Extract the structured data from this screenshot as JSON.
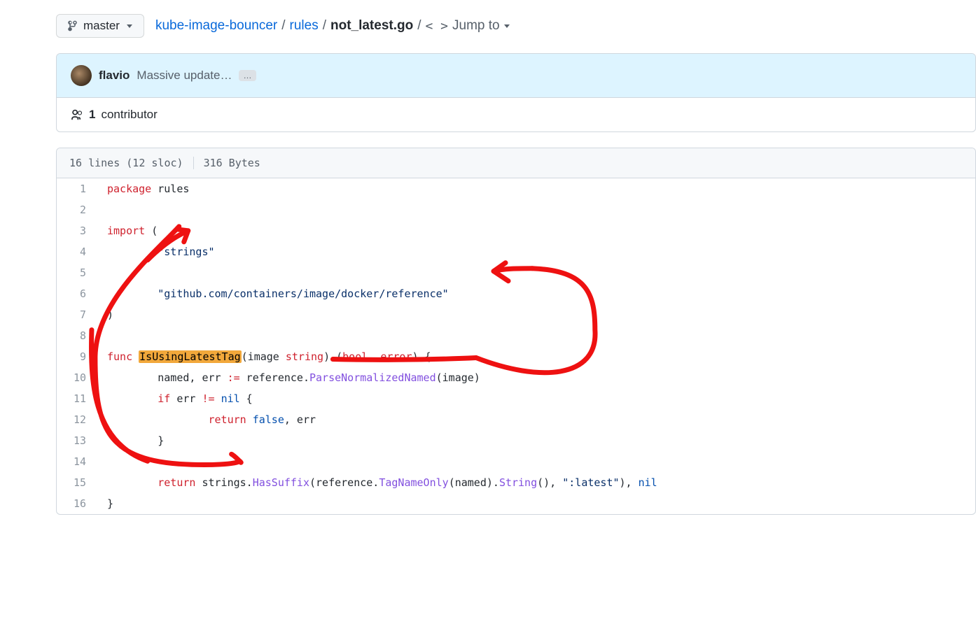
{
  "branch": {
    "label": "master"
  },
  "breadcrumb": {
    "repo": "kube-image-bouncer",
    "dir": "rules",
    "file": "not_latest.go",
    "sep": "/",
    "jump_to": "Jump to"
  },
  "commit": {
    "author": "flavio",
    "message": "Massive update…",
    "expand": "…"
  },
  "contributors": {
    "count": "1",
    "label": "contributor"
  },
  "blob_info": {
    "lines_sloc": "16 lines (12 sloc)",
    "bytes": "316 Bytes"
  },
  "code": {
    "lines": [
      {
        "n": "1",
        "t": [
          {
            "c": "kw",
            "v": "package"
          },
          {
            "v": " rules"
          }
        ]
      },
      {
        "n": "2",
        "t": []
      },
      {
        "n": "3",
        "t": [
          {
            "c": "kw",
            "v": "import"
          },
          {
            "v": " ("
          }
        ]
      },
      {
        "n": "4",
        "t": [
          {
            "v": "        "
          },
          {
            "c": "str",
            "v": "\"strings\""
          }
        ]
      },
      {
        "n": "5",
        "t": []
      },
      {
        "n": "6",
        "t": [
          {
            "v": "        "
          },
          {
            "c": "str",
            "v": "\"github.com/containers/image/docker/reference\""
          }
        ]
      },
      {
        "n": "7",
        "t": [
          {
            "v": ")"
          }
        ]
      },
      {
        "n": "8",
        "t": []
      },
      {
        "n": "9",
        "t": [
          {
            "c": "kw",
            "v": "func"
          },
          {
            "v": " "
          },
          {
            "c": "hl",
            "v": "IsUsingLatestTag"
          },
          {
            "v": "(image "
          },
          {
            "c": "kw",
            "v": "string"
          },
          {
            "v": ") ("
          },
          {
            "c": "kw",
            "v": "bool"
          },
          {
            "v": ", "
          },
          {
            "c": "kw",
            "v": "error"
          },
          {
            "v": ") {"
          }
        ]
      },
      {
        "n": "10",
        "t": [
          {
            "v": "        named, err "
          },
          {
            "c": "kw",
            "v": ":="
          },
          {
            "v": " reference."
          },
          {
            "c": "fn-call",
            "v": "ParseNormalizedNamed"
          },
          {
            "v": "(image)"
          }
        ]
      },
      {
        "n": "11",
        "t": [
          {
            "v": "        "
          },
          {
            "c": "kw",
            "v": "if"
          },
          {
            "v": " err "
          },
          {
            "c": "kw",
            "v": "!="
          },
          {
            "v": " "
          },
          {
            "c": "nil",
            "v": "nil"
          },
          {
            "v": " {"
          }
        ]
      },
      {
        "n": "12",
        "t": [
          {
            "v": "                "
          },
          {
            "c": "kw",
            "v": "return"
          },
          {
            "v": " "
          },
          {
            "c": "nil",
            "v": "false"
          },
          {
            "v": ", err"
          }
        ]
      },
      {
        "n": "13",
        "t": [
          {
            "v": "        }"
          }
        ]
      },
      {
        "n": "14",
        "t": []
      },
      {
        "n": "15",
        "t": [
          {
            "v": "        "
          },
          {
            "c": "kw",
            "v": "return"
          },
          {
            "v": " strings."
          },
          {
            "c": "fn-call",
            "v": "HasSuffix"
          },
          {
            "v": "(reference."
          },
          {
            "c": "fn-call",
            "v": "TagNameOnly"
          },
          {
            "v": "(named)."
          },
          {
            "c": "fn-call",
            "v": "String"
          },
          {
            "v": "(), "
          },
          {
            "c": "str",
            "v": "\":latest\""
          },
          {
            "v": "), "
          },
          {
            "c": "nil",
            "v": "nil"
          }
        ]
      },
      {
        "n": "16",
        "t": [
          {
            "v": "}"
          }
        ]
      }
    ]
  }
}
